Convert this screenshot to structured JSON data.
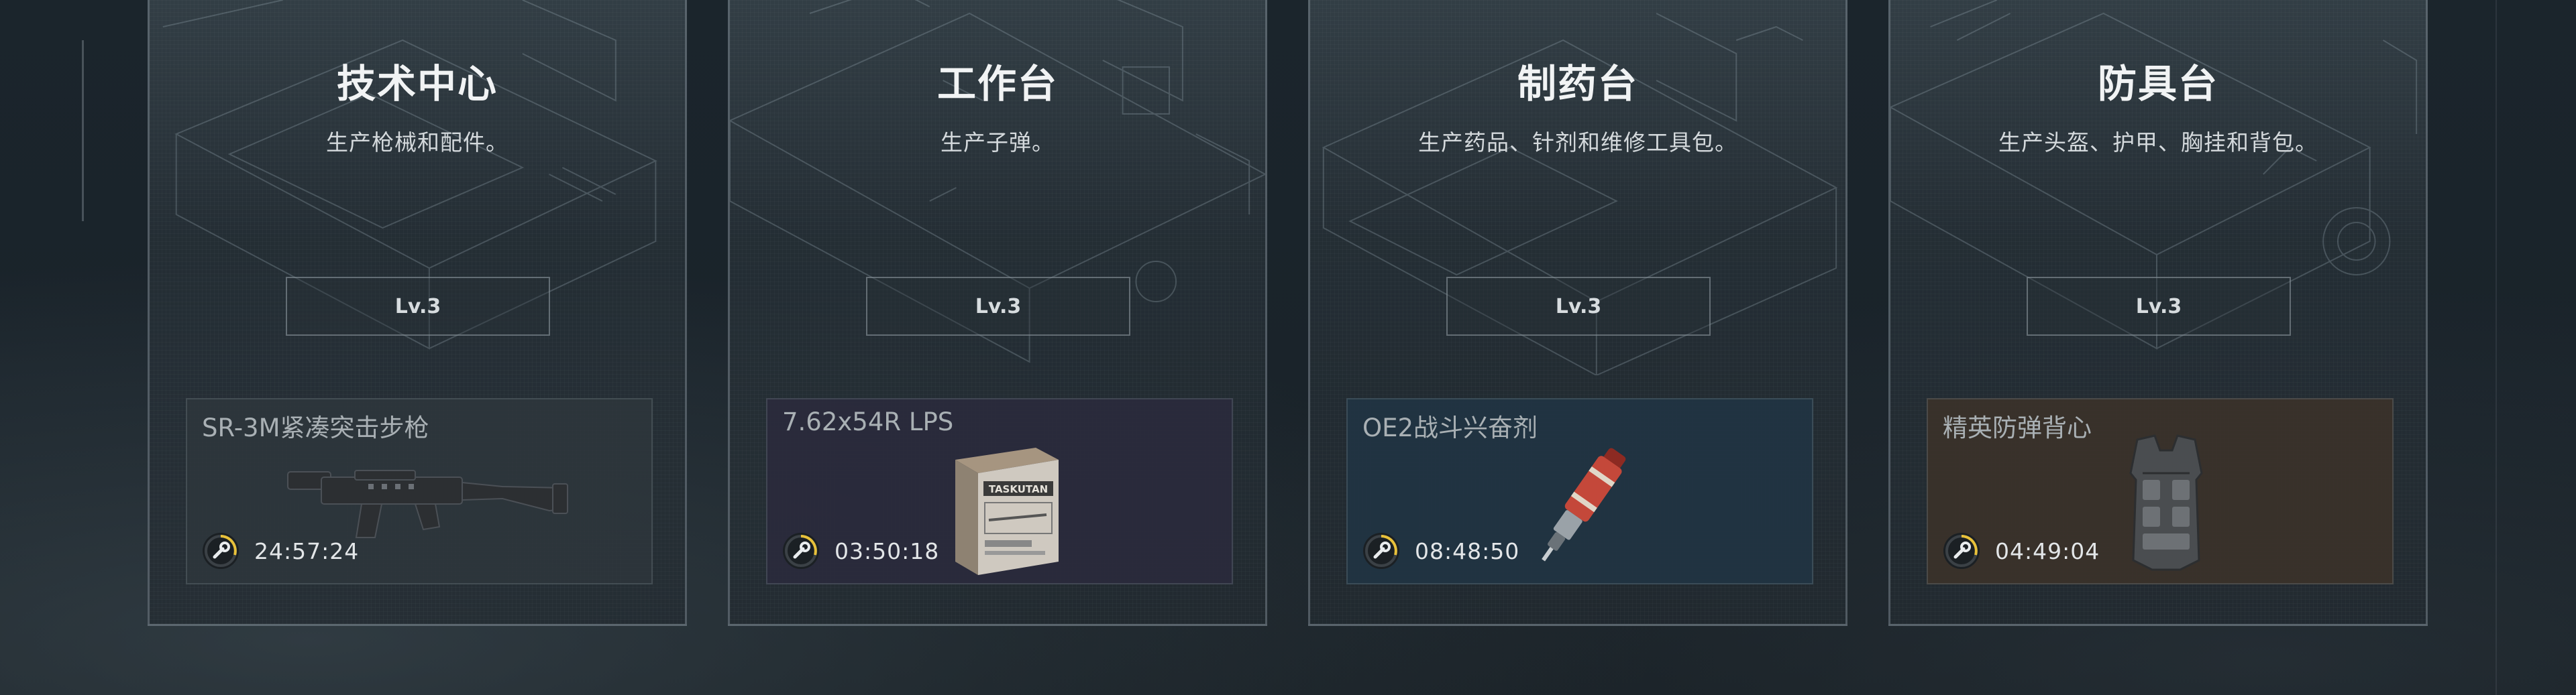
{
  "stations": [
    {
      "title": "技术中心",
      "description": "生产枪械和配件。",
      "level": "Lv.3",
      "crafting": {
        "item_name": "SR-3M紧凑突击步枪",
        "time_remaining": "24:57:24",
        "icon": "wrench-timer-icon"
      }
    },
    {
      "title": "工作台",
      "description": "生产子弹。",
      "level": "Lv.3",
      "crafting": {
        "item_name": "7.62x54R LPS",
        "time_remaining": "03:50:18",
        "box_label": "TASKUTAN",
        "icon": "wrench-timer-icon"
      }
    },
    {
      "title": "制药台",
      "description": "生产药品、针剂和维修工具包。",
      "level": "Lv.3",
      "crafting": {
        "item_name": "OE2战斗兴奋剂",
        "time_remaining": "08:48:50",
        "icon": "wrench-timer-icon"
      }
    },
    {
      "title": "防具台",
      "description": "生产头盔、护甲、胸挂和背包。",
      "level": "Lv.3",
      "crafting": {
        "item_name": "精英防弹背心",
        "time_remaining": "04:49:04",
        "icon": "wrench-timer-icon"
      }
    }
  ],
  "colors": {
    "timer_accent": "#e8c13a",
    "panel_weapon": "#2e363c",
    "panel_ammo": "#2a2a3c",
    "panel_medical": "#213442",
    "panel_armor": "#3a322a"
  }
}
